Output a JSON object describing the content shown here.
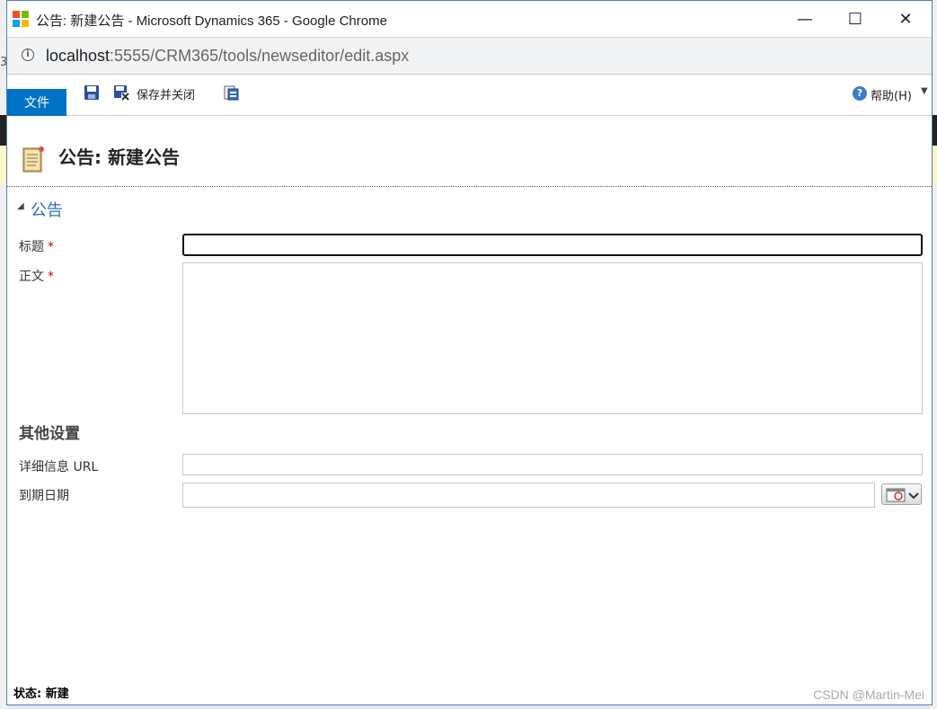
{
  "window": {
    "title": "公告: 新建公告 - Microsoft Dynamics 365 - Google Chrome",
    "minimize_glyph": "—",
    "maximize_glyph": "☐",
    "close_glyph": "✕"
  },
  "address_bar": {
    "host": "localhost",
    "path": ":5555/CRM365/tools/newseditor/edit.aspx"
  },
  "background": {
    "left_fragment": "3"
  },
  "ribbon": {
    "file_tab": "文件",
    "save_and_close": "保存并关闭",
    "help": "帮助(H)",
    "icons": [
      "save-icon",
      "save-and-close-icon",
      "entity-options-icon",
      "help-icon"
    ]
  },
  "header": {
    "title": "公告: 新建公告"
  },
  "form": {
    "section_title": "公告",
    "title_label": "标题",
    "body_label": "正文",
    "required_mark": "*",
    "title_value": "",
    "body_value": "",
    "other_settings": "其他设置",
    "url_label": "详细信息 URL",
    "url_value": "",
    "due_date_label": "到期日期",
    "due_date_value": ""
  },
  "status_bar": {
    "status": "状态: 新建"
  },
  "watermark": "CSDN @Martin-Mei",
  "colors": {
    "accent": "#0072c6",
    "section": "#2e6fb7",
    "required": "#cc0000"
  }
}
